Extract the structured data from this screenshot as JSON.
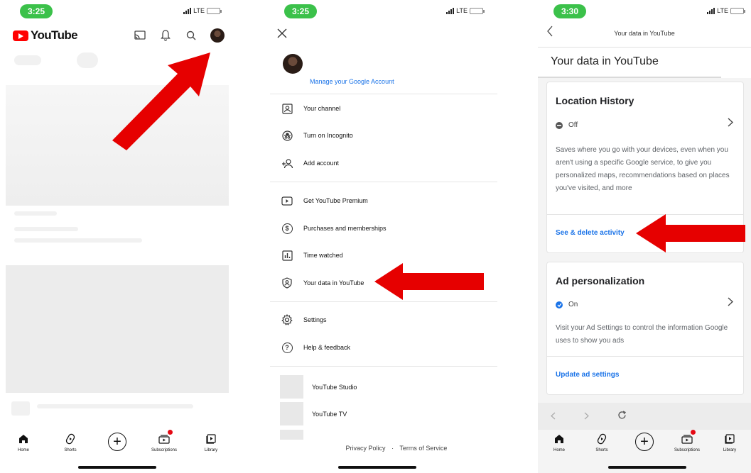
{
  "screens": [
    {
      "time": "3:25",
      "network": "LTE",
      "brand": "YouTube",
      "header_icons": [
        "cast-icon",
        "bell-icon",
        "search-icon",
        "avatar"
      ],
      "bottom_nav": [
        {
          "label": "Home",
          "icon": "home-icon"
        },
        {
          "label": "Shorts",
          "icon": "shorts-icon"
        },
        {
          "label": "",
          "icon": "create-icon"
        },
        {
          "label": "Subscriptions",
          "icon": "subscriptions-icon"
        },
        {
          "label": "Library",
          "icon": "library-icon"
        }
      ]
    },
    {
      "time": "3:25",
      "network": "LTE",
      "manage_account": "Manage your Google Account",
      "menu_group_1": [
        {
          "label": "Your channel",
          "icon": "channel-icon"
        },
        {
          "label": "Turn on Incognito",
          "icon": "incognito-icon"
        },
        {
          "label": "Add account",
          "icon": "add-account-icon"
        }
      ],
      "menu_group_2": [
        {
          "label": "Get YouTube Premium",
          "icon": "premium-icon"
        },
        {
          "label": "Purchases and memberships",
          "icon": "dollar-icon"
        },
        {
          "label": "Time watched",
          "icon": "chart-icon"
        },
        {
          "label": "Your data in YouTube",
          "icon": "shield-person-icon"
        }
      ],
      "menu_group_3": [
        {
          "label": "Settings",
          "icon": "gear-icon"
        },
        {
          "label": "Help & feedback",
          "icon": "help-icon"
        }
      ],
      "apps": [
        {
          "label": "YouTube Studio"
        },
        {
          "label": "YouTube TV"
        }
      ],
      "footer": {
        "privacy": "Privacy Policy",
        "separator": "·",
        "terms": "Terms of Service"
      }
    },
    {
      "time": "3:30",
      "network": "LTE",
      "title": "Your data in YouTube",
      "heading": "Your data in YouTube",
      "location_card": {
        "title": "Location History",
        "state": "Off",
        "description": "Saves where you go with your devices, even when you aren't using a specific Google service, to give you personalized maps, recommendations based on places you've visited, and more",
        "link": "See & delete activity"
      },
      "ad_card": {
        "title": "Ad personalization",
        "state": "On",
        "description": "Visit your Ad Settings to control the information Google uses to show you ads",
        "link": "Update ad settings"
      },
      "bottom_nav": [
        {
          "label": "Home",
          "icon": "home-icon"
        },
        {
          "label": "Shorts",
          "icon": "shorts-icon"
        },
        {
          "label": "",
          "icon": "create-icon"
        },
        {
          "label": "Subscriptions",
          "icon": "subscriptions-icon"
        },
        {
          "label": "Library",
          "icon": "library-icon"
        }
      ]
    }
  ],
  "colors": {
    "youtube_red": "#ff0000",
    "arrow_red": "#e60000",
    "link_blue": "#1a73e8",
    "status_green": "#3bc14a"
  }
}
